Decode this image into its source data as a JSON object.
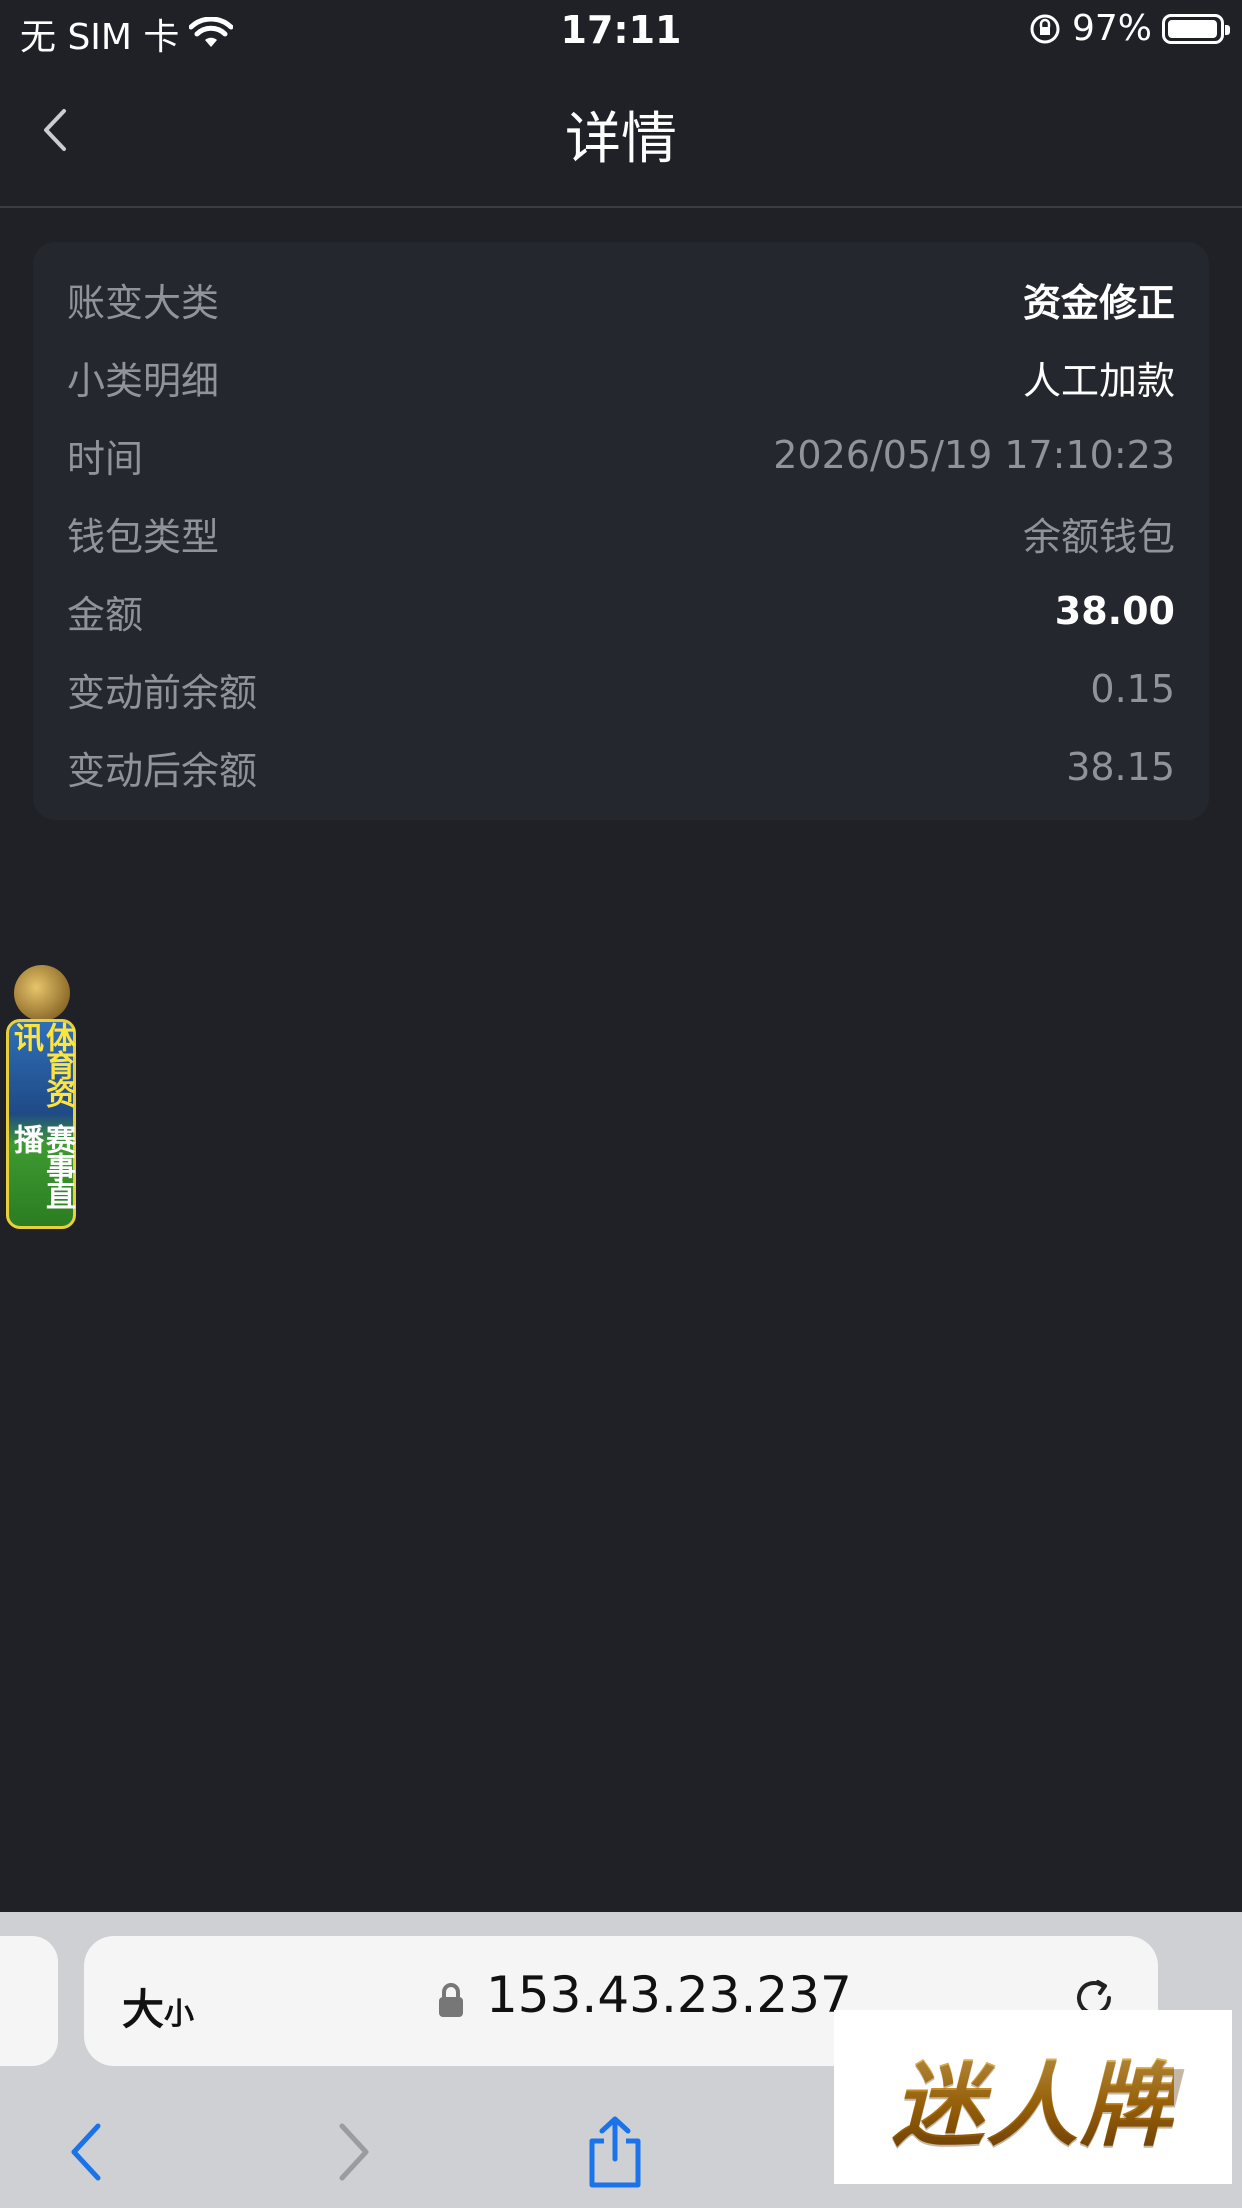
{
  "status_bar": {
    "carrier": "无 SIM 卡",
    "time": "17:11",
    "battery": "97%",
    "battery_level": 0.97
  },
  "nav": {
    "title": "详情"
  },
  "detail": {
    "rows": [
      {
        "label": "账变大类",
        "value": "资金修正"
      },
      {
        "label": "小类明细",
        "value": "人工加款"
      },
      {
        "label": "时间",
        "value": "2026/05/19 17:10:23"
      },
      {
        "label": "钱包类型",
        "value": "余额钱包"
      },
      {
        "label": "金额",
        "value": "38.00"
      },
      {
        "label": "变动前余额",
        "value": "0.15"
      },
      {
        "label": "变动后余额",
        "value": "38.15"
      }
    ]
  },
  "float_ad": {
    "line1": "体育资讯",
    "line2": "赛事直播"
  },
  "browser": {
    "text_size_big": "大",
    "text_size_small": "小",
    "url": "153.43.23.237"
  },
  "watermark": {
    "text": "迷人牌"
  }
}
